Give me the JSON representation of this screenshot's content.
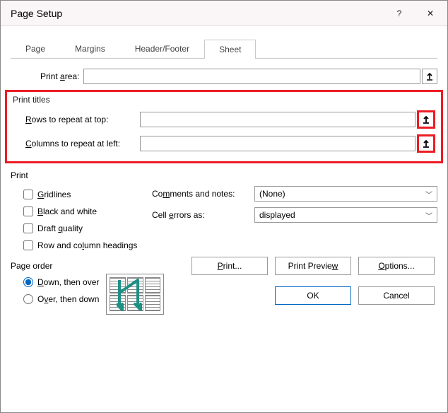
{
  "title": "Page Setup",
  "helpGlyph": "?",
  "closeGlyph": "✕",
  "tabs": {
    "page": "Page",
    "margins": "Margins",
    "headerfooter": "Header/Footer",
    "sheet": "Sheet"
  },
  "printArea": {
    "label": "Print area:",
    "value": ""
  },
  "printTitles": {
    "group": "Print titles",
    "rowsLabel": "Rows to repeat at top:",
    "rowsValue": "",
    "colsLabel": "Columns to repeat at left:",
    "colsValue": ""
  },
  "printSection": {
    "group": "Print",
    "gridlines": "Gridlines",
    "bw": "Black and white",
    "draft": "Draft quality",
    "rch": "Row and column headings",
    "commentsLabel": "Comments and notes:",
    "commentsValue": "(None)",
    "errorsLabel": "Cell errors as:",
    "errorsValue": "displayed"
  },
  "pageOrder": {
    "group": "Page order",
    "down": "Down, then over",
    "over": "Over, then down"
  },
  "buttons": {
    "print": "Print...",
    "preview": "Print Preview",
    "options": "Options...",
    "ok": "OK",
    "cancel": "Cancel"
  }
}
